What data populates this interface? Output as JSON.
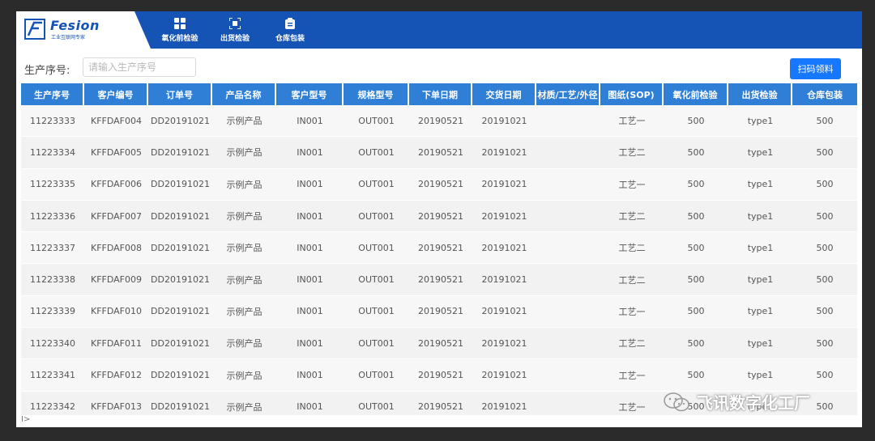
{
  "brand": {
    "name": "Fesion",
    "tagline": "工业互联网专家"
  },
  "nav": [
    {
      "label": "氧化前检验",
      "icon": "grid-icon"
    },
    {
      "label": "出货检验",
      "icon": "scan-icon"
    },
    {
      "label": "仓库包装",
      "icon": "clipboard-icon"
    }
  ],
  "search": {
    "label": "生产序号:",
    "placeholder": "请输入生产序号",
    "value": ""
  },
  "scan_button_label": "扫码领料",
  "table": {
    "headers": [
      "生产序号",
      "客户编号",
      "订单号",
      "产品名称",
      "客户型号",
      "规格型号",
      "下单日期",
      "交货日期",
      "材质/工艺/外径",
      "图纸(SOP)",
      "氧化前检验",
      "出货检验",
      "仓库包装"
    ],
    "rows": [
      [
        "11223333",
        "KFFDAF004",
        "DD20191021",
        "示例产品",
        "IN001",
        "OUT001",
        "20190521",
        "20191021",
        "工艺一",
        "500",
        "type1",
        "500"
      ],
      [
        "11223334",
        "KFFDAF005",
        "DD20191021",
        "示例产品",
        "IN001",
        "OUT001",
        "20190521",
        "20191021",
        "工艺二",
        "500",
        "type1",
        "500"
      ],
      [
        "11223335",
        "KFFDAF006",
        "DD20191021",
        "示例产品",
        "IN001",
        "OUT001",
        "20190521",
        "20191021",
        "工艺一",
        "500",
        "type1",
        "500"
      ],
      [
        "11223336",
        "KFFDAF007",
        "DD20191021",
        "示例产品",
        "IN001",
        "OUT001",
        "20190521",
        "20191021",
        "工艺二",
        "500",
        "type1",
        "500"
      ],
      [
        "11223337",
        "KFFDAF008",
        "DD20191021",
        "示例产品",
        "IN001",
        "OUT001",
        "20190521",
        "20191021",
        "工艺二",
        "500",
        "type1",
        "500"
      ],
      [
        "11223338",
        "KFFDAF009",
        "DD20191021",
        "示例产品",
        "IN001",
        "OUT001",
        "20190521",
        "20191021",
        "工艺二",
        "500",
        "type1",
        "500"
      ],
      [
        "11223339",
        "KFFDAF010",
        "DD20191021",
        "示例产品",
        "IN001",
        "OUT001",
        "20190521",
        "20191021",
        "工艺一",
        "500",
        "type1",
        "500"
      ],
      [
        "11223340",
        "KFFDAF011",
        "DD20191021",
        "示例产品",
        "IN001",
        "OUT001",
        "20190521",
        "20191021",
        "工艺二",
        "500",
        "type1",
        "500"
      ],
      [
        "11223341",
        "KFFDAF012",
        "DD20191021",
        "示例产品",
        "IN001",
        "OUT001",
        "20190521",
        "20191021",
        "工艺一",
        "500",
        "type1",
        "500"
      ],
      [
        "11223342",
        "KFFDAF013",
        "DD20191021",
        "示例产品",
        "IN001",
        "OUT001",
        "20190521",
        "20191021",
        "工艺一",
        "500",
        "type1",
        "500"
      ]
    ]
  },
  "footer_toggle": "I>",
  "watermark": "飞讯数字化工厂",
  "colors": {
    "header": "#1553b5",
    "table_header": "#2f7fd6",
    "button": "#1677ff"
  }
}
